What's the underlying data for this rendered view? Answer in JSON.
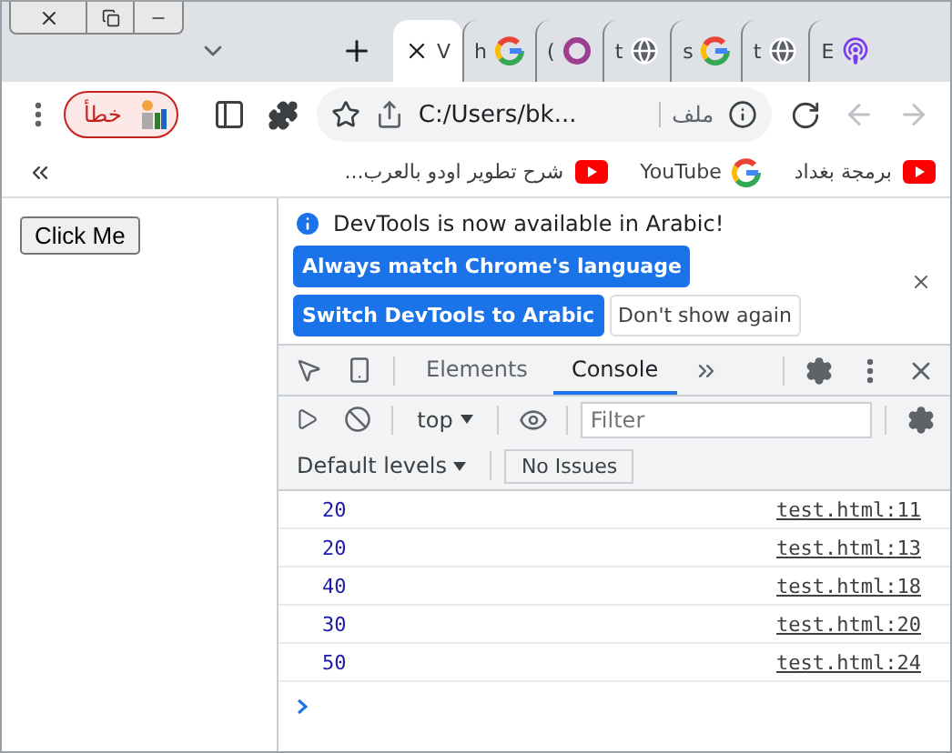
{
  "tab_strip": {
    "tabs": [
      {
        "title": "V",
        "selected": true
      },
      {
        "title": "h",
        "selected": false
      },
      {
        "title": "(",
        "selected": false
      },
      {
        "title": "t",
        "selected": false
      },
      {
        "title": "s",
        "selected": false
      },
      {
        "title": "t",
        "selected": false
      },
      {
        "title": "E",
        "selected": false
      }
    ]
  },
  "toolbar": {
    "profile": {
      "label": "خطأ"
    },
    "address": {
      "url": "C:/Users/bk...",
      "scheme_label": "ملف"
    }
  },
  "bookmarks": [
    {
      "label": "برمجة بغداد"
    },
    {
      "label": "YouTube"
    },
    {
      "label": "شرح تطوير اودو بالعرب..."
    }
  ],
  "page": {
    "button": "Click Me"
  },
  "devtools": {
    "infobar": {
      "message": "DevTools is now available in Arabic!",
      "buttons": [
        {
          "label": "Always match Chrome's language",
          "kind": "primary"
        },
        {
          "label": "Switch DevTools to Arabic",
          "kind": "primary"
        },
        {
          "label": "Don't show again",
          "kind": "secondary"
        }
      ]
    },
    "tabs": [
      {
        "label": "Elements",
        "selected": false
      },
      {
        "label": "Console",
        "selected": true
      }
    ],
    "console_toolbar": {
      "context": "top",
      "filter_placeholder": "Filter",
      "levels": "Default levels",
      "issues": "No Issues"
    },
    "messages": [
      {
        "value": "20",
        "source": "test.html:11"
      },
      {
        "value": "20",
        "source": "test.html:13"
      },
      {
        "value": "40",
        "source": "test.html:18"
      },
      {
        "value": "30",
        "source": "test.html:20"
      },
      {
        "value": "50",
        "source": "test.html:24"
      }
    ]
  }
}
